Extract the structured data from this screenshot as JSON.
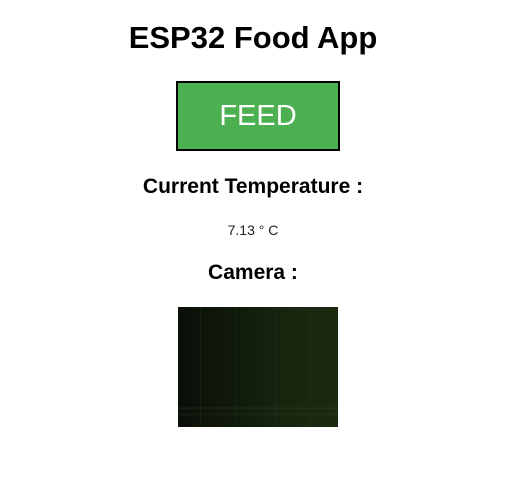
{
  "app": {
    "title": "ESP32 Food App"
  },
  "controls": {
    "feed_label": "FEED",
    "feed_color": "#4caf50"
  },
  "temperature": {
    "heading": "Current Temperature :",
    "value": "7.13 ° C"
  },
  "camera": {
    "heading": "Camera :"
  }
}
